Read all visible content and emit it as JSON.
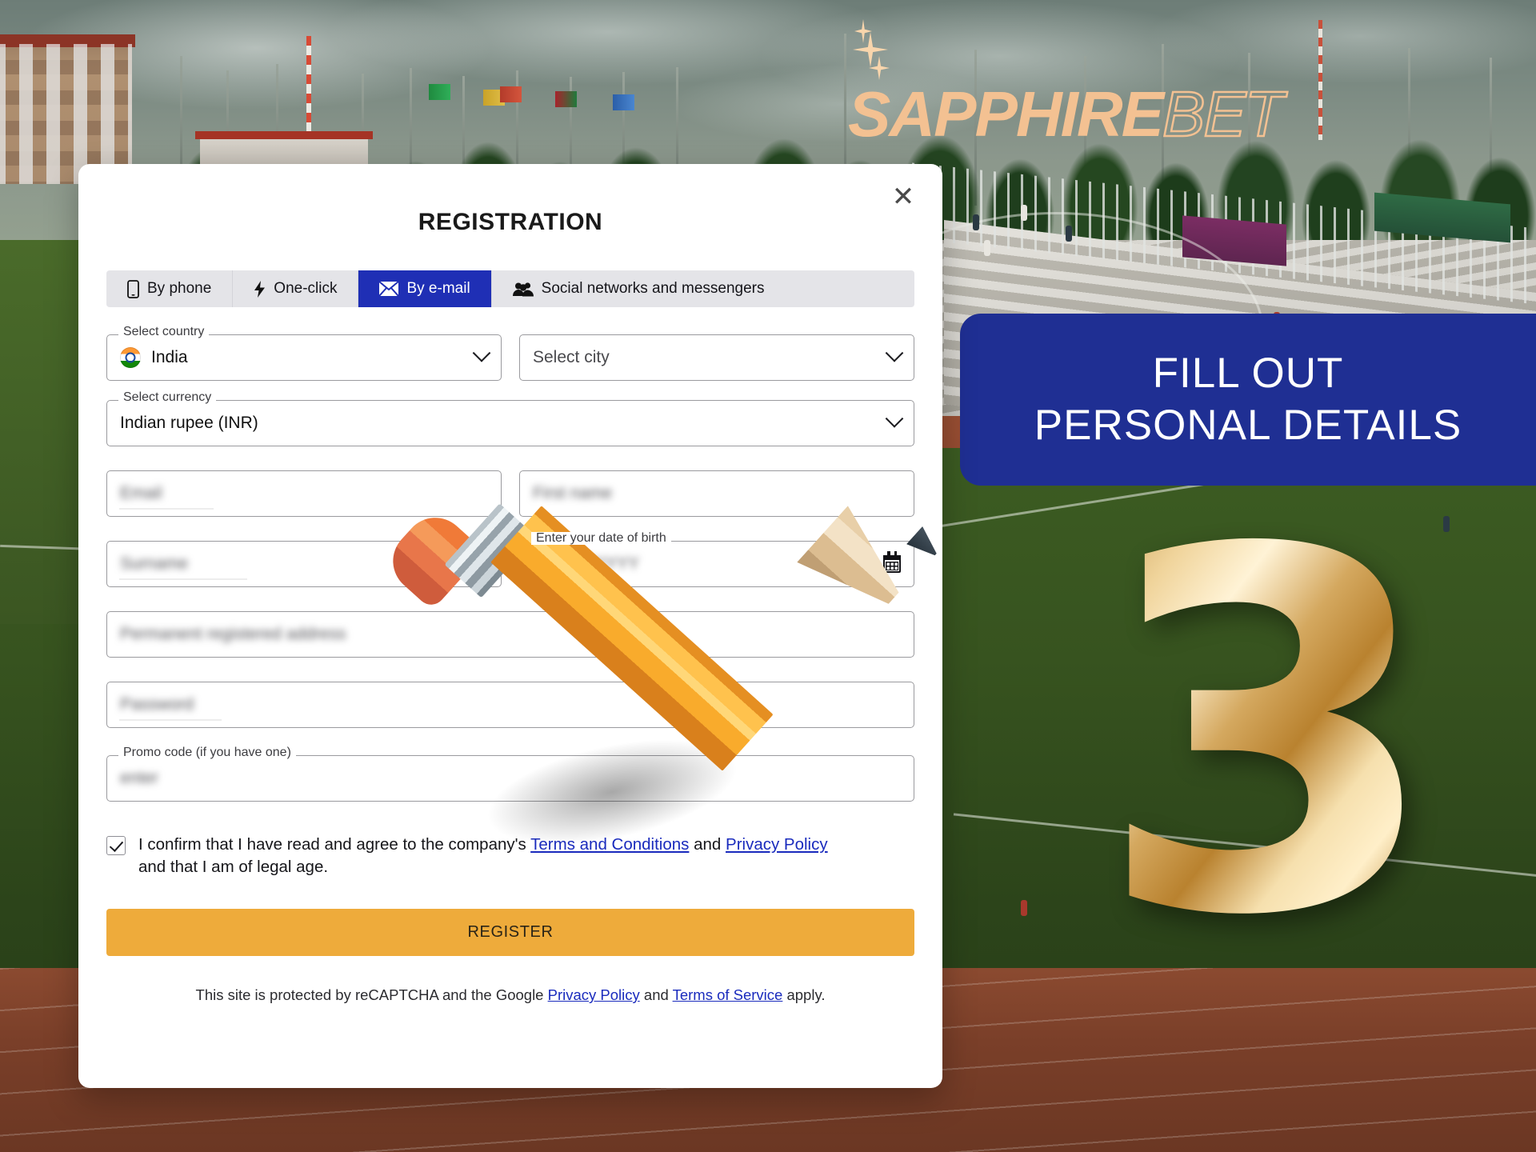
{
  "brand": {
    "logo_primary": "SAPPHIRE",
    "logo_secondary": "BET",
    "logo_color": "#f3c192"
  },
  "banner": {
    "line1": "FILL OUT",
    "line2": "PERSONAL DETAILS",
    "bg_color": "#1f2f93",
    "text_color": "#ffffff"
  },
  "step_number": "3",
  "modal": {
    "title": "REGISTRATION",
    "close_label": "✕",
    "tabs": [
      {
        "label": "By phone",
        "icon": "phone-icon",
        "active": false
      },
      {
        "label": "One-click",
        "icon": "lightning-icon",
        "active": false
      },
      {
        "label": "By e-mail",
        "icon": "envelope-icon",
        "active": true
      },
      {
        "label": "Social networks and messengers",
        "icon": "people-icon",
        "active": false
      }
    ],
    "active_tab_color": "#1f2fb5",
    "fields": {
      "country": {
        "legend": "Select country",
        "value": "India",
        "icon": "india-flag-icon"
      },
      "city": {
        "legend": "",
        "placeholder": "Select city",
        "value": ""
      },
      "currency": {
        "legend": "Select currency",
        "value": "Indian rupee (INR)"
      },
      "email": {
        "legend": "",
        "value": "Email",
        "blurred": true
      },
      "first_name": {
        "legend": "",
        "value": "First name",
        "blurred": true
      },
      "surname": {
        "legend": "",
        "value": "Surname",
        "blurred": true
      },
      "date_of_birth": {
        "legend": "Enter your date of birth",
        "value": "DD/MM/YYYY",
        "blurred": true,
        "icon": "calendar-icon"
      },
      "address": {
        "legend": "",
        "value": "Permanent registered address",
        "blurred": true
      },
      "password": {
        "legend": "",
        "value": "Password",
        "blurred": true
      },
      "promo_code": {
        "legend": "Promo code (if you have one)",
        "value": "enter",
        "blurred": true
      }
    },
    "terms": {
      "checked": true,
      "part1": "I confirm that I have read and agree to the company's ",
      "link1": "Terms and Conditions",
      "part2": " and ",
      "link2": "Privacy Policy",
      "part3": " and that I am of legal age."
    },
    "submit_label": "REGISTER",
    "submit_color": "#eeab3b",
    "recaptcha": {
      "part1": "This site is protected by reCAPTCHA and the Google ",
      "link1": "Privacy Policy",
      "part2": " and ",
      "link2": "Terms of Service",
      "part3": " apply."
    }
  }
}
